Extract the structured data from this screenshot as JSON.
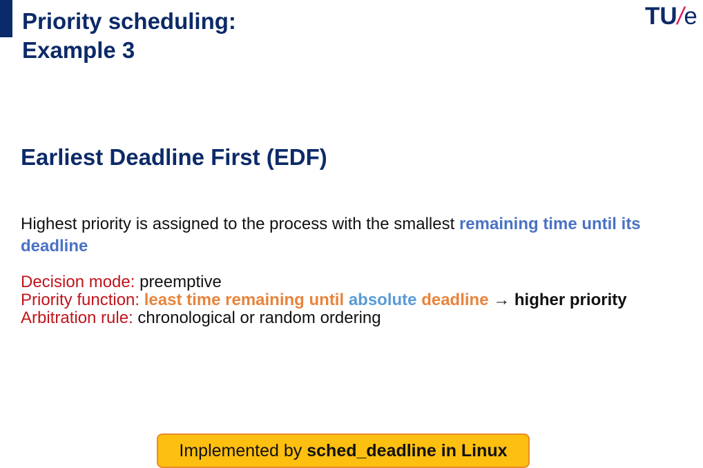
{
  "slide": {
    "title_line1": "Priority scheduling:",
    "title_line2": "Example 3",
    "logo": {
      "tu": "TU",
      "slash": "/",
      "e": "e"
    },
    "subtitle": "Earliest Deadline First (EDF)",
    "paragraph": {
      "plain": "Highest priority is assigned to the process with the smallest ",
      "highlight": "remaining time until its deadline"
    },
    "properties": {
      "decision_mode_label": "Decision mode:",
      "decision_mode_value": "preemptive",
      "priority_function_label": "Priority function:",
      "pf_part1": "least time remaining until",
      "pf_part2": "absolute",
      "pf_part3": "deadline",
      "pf_arrow": "→",
      "pf_result": "higher priority",
      "arbitration_label": "Arbitration rule:",
      "arbitration_value": "chronological or random ordering"
    },
    "callout": {
      "prefix": "Implemented by ",
      "bold": "sched_deadline in Linux"
    }
  },
  "colors": {
    "title_navy": "#0c2a68",
    "label_red": "#c0141b",
    "orange": "#e8843c",
    "blue": "#5a9ad6",
    "highlight_blue": "#4a72c4",
    "callout_yellow": "#fdbf10",
    "logo_pink": "#d81e5b"
  }
}
